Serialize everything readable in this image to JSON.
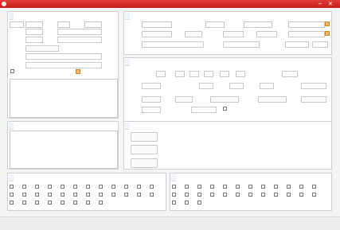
{
  "window": {
    "title": "",
    "minimize_icon": "minimize-icon",
    "close_icon": "close-icon",
    "title_color": "#d32020"
  },
  "panels": {
    "owner": {
      "title": ""
    },
    "property": {
      "title": ""
    },
    "details": {
      "title": ""
    },
    "remarks": {
      "title": ""
    },
    "photos": {
      "title": ""
    },
    "facilities": {
      "title": ""
    },
    "surroundings": {
      "title": ""
    }
  },
  "photo_buttons": {
    "indoor": "",
    "floor_plan": "",
    "exterior": ""
  },
  "footer": {
    "save": "",
    "save_next": ""
  },
  "colors": {
    "accent": "#1f4aa8",
    "title_bar": "#d32020",
    "panel_header_bg": "#eef3fb"
  }
}
